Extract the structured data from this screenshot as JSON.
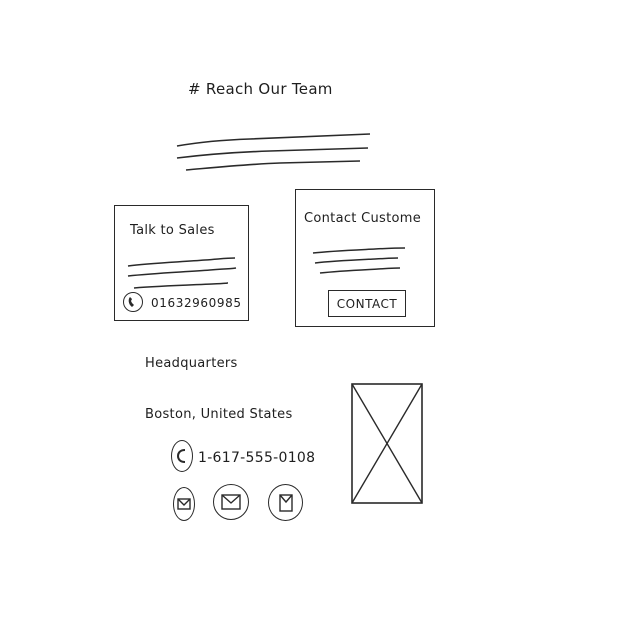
{
  "page": {
    "title": "# Reach Our Team"
  },
  "sales_card": {
    "title": "Talk to Sales",
    "phone": "01632960985",
    "phone_icon": "phone-icon"
  },
  "customer_card": {
    "title": "Contact Custome",
    "button_label": "CONTACT"
  },
  "headquarters": {
    "heading": "Headquarters",
    "location": "Boston, United States",
    "phone": "1-617-555-0108",
    "phone_icon": "phone-icon",
    "social_icons": [
      "mail-icon",
      "mail-icon",
      "mail-icon"
    ]
  },
  "image_placeholder": {
    "icon": "image-placeholder-icon"
  },
  "colors": {
    "ink": "#2a2a2a",
    "background": "#ffffff"
  }
}
